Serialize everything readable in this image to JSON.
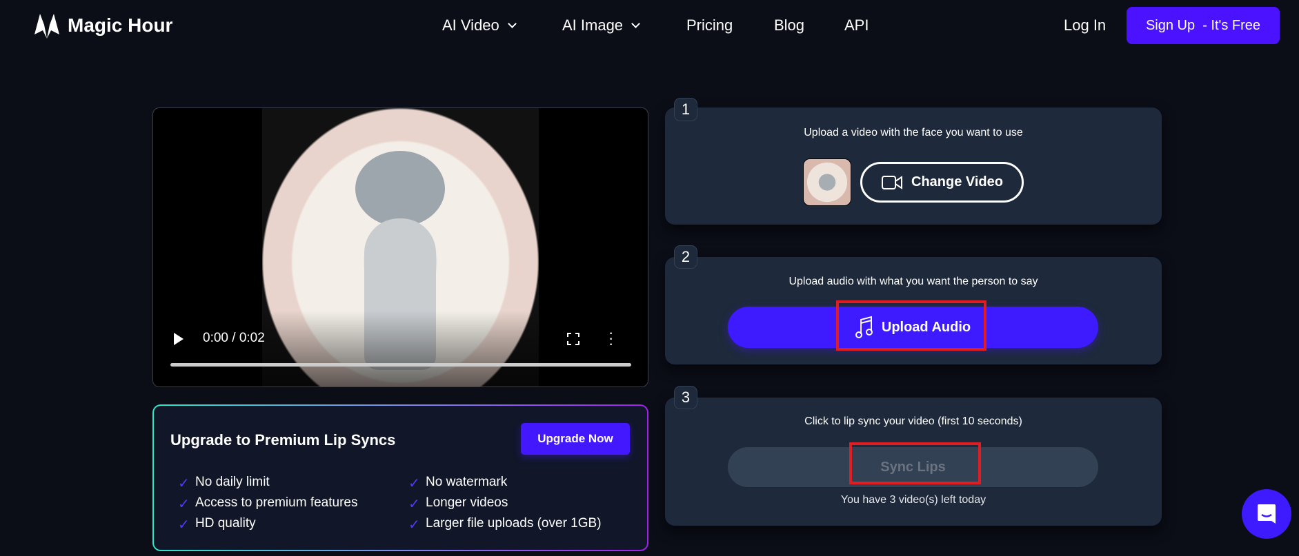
{
  "nav": {
    "brand": "Magic Hour",
    "items": [
      {
        "label": "AI Video",
        "dropdown": true
      },
      {
        "label": "AI Image",
        "dropdown": true
      },
      {
        "label": "Pricing"
      },
      {
        "label": "Blog"
      },
      {
        "label": "API"
      }
    ],
    "login": "Log In",
    "signup": "Sign Up  - It's Free"
  },
  "video": {
    "time": "0:00 / 0:02",
    "progress": 0
  },
  "upgrade": {
    "title": "Upgrade to Premium Lip Syncs",
    "button": "Upgrade Now",
    "features_left": [
      "No daily limit",
      "Access to premium features",
      "HD quality"
    ],
    "features_right": [
      "No watermark",
      "Longer videos",
      "Larger file uploads (over 1GB)"
    ]
  },
  "steps": [
    {
      "number": "1",
      "text": "Upload a video with the face you want to use",
      "button": "Change Video"
    },
    {
      "number": "2",
      "text": "Upload audio with what you want the person to say",
      "button": "Upload Audio"
    },
    {
      "number": "3",
      "text": "Click to lip sync your video (first 10 seconds)",
      "button": "Sync Lips",
      "note": "You have 3 video(s) left today"
    }
  ],
  "colors": {
    "accent": "#4318ff",
    "card": "#1e293b",
    "background": "#0b0d17",
    "highlight": "#e11d24"
  }
}
